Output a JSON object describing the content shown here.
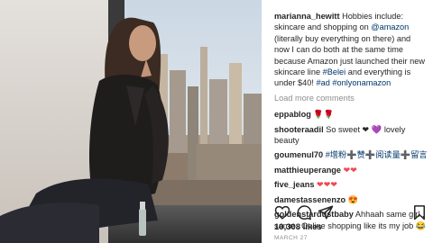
{
  "post": {
    "caption": {
      "user": "marianna_hewitt",
      "text_1": "Hobbies include: skincare and shopping on ",
      "mention": "@amazon",
      "text_2": " (literally buy everything on there) and now I can do both at the same time because Amazon just launched their new skincare line ",
      "tag_1": "#Belei",
      "text_3": " and everything is under $40! ",
      "tag_2": "#ad",
      "text_4": " ",
      "tag_3": "#onlyonamazon"
    },
    "load_more_label": "Load more comments",
    "comments": [
      {
        "user": "eppablog",
        "text": "🌹🌹"
      },
      {
        "user": "shooteraadil",
        "text_a": "So sweet ",
        "emoji_1": "❤",
        "text_b": " ",
        "emoji_2": "💜",
        "text_c": " lovely beauty"
      },
      {
        "user": "goumenul70",
        "text": "#增粉➕赞➕阅读量➕留言"
      },
      {
        "user": "matthieuperange",
        "text": "❤❤"
      },
      {
        "user": "five_jeans",
        "text": "❤❤❤"
      },
      {
        "user": "damestassenenzo",
        "text": "😍"
      },
      {
        "user": "goldenstardustbaby",
        "text": "Ahhaah same girl , same . Online shopping like its my job 😂"
      }
    ],
    "likes": "10,308 likes",
    "date": "MARCH 27"
  },
  "icons": {
    "like": "heart-icon",
    "comment": "comment-icon",
    "share": "share-icon",
    "save": "bookmark-icon"
  },
  "colors": {
    "link": "#00376b",
    "muted": "#8e8e8e",
    "text": "#262626",
    "heart": "#ed4956"
  }
}
